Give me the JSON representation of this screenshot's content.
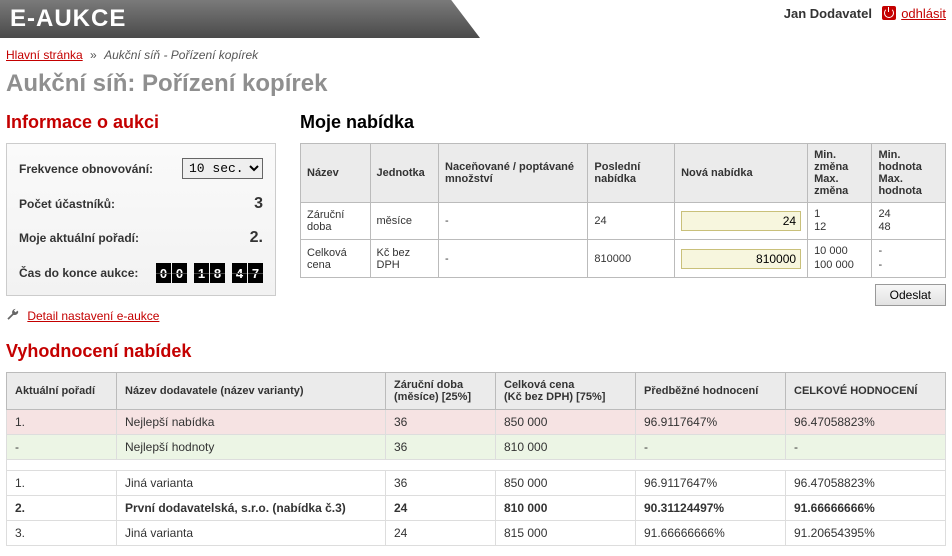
{
  "header": {
    "brand": "E-AUKCE",
    "user_name": "Jan Dodavatel",
    "logout_label": "odhlásit"
  },
  "breadcrumbs": {
    "home": "Hlavní stránka",
    "separator": "»",
    "tail": "Aukční síň - Pořízení kopírek"
  },
  "page_title": "Aukční síň: Pořízení kopírek",
  "info_panel": {
    "title": "Informace o aukci",
    "refresh_label": "Frekvence obnovování:",
    "refresh_value": "10 sec.",
    "participants_label": "Počet účastníků:",
    "participants_value": "3",
    "rank_label": "Moje aktuální pořadí:",
    "rank_value": "2.",
    "time_label": "Čas do konce aukce:",
    "countdown": {
      "hh": "00",
      "mm": "18",
      "ss": "47"
    },
    "detail_link": "Detail nastavení e-aukce"
  },
  "offer": {
    "title": "Moje nabídka",
    "cols": {
      "name": "Název",
      "unit": "Jednotka",
      "qty": "Naceňované / poptávané množství",
      "last": "Poslední nabídka",
      "new": "Nová nabídka",
      "minmax_change": "Min. změna\nMax. změna",
      "minmax_value": "Min. hodnota\nMax. hodnota"
    },
    "rows": [
      {
        "name": "Záruční doba",
        "unit": "měsíce",
        "qty": "-",
        "last": "24",
        "new": "24",
        "change_min": "1",
        "change_max": "12",
        "value_min": "24",
        "value_max": "48"
      },
      {
        "name": "Celková cena",
        "unit": "Kč bez DPH",
        "qty": "-",
        "last": "810000",
        "new": "810000",
        "change_min": "10 000",
        "change_max": "100 000",
        "value_min": "-",
        "value_max": "-"
      }
    ],
    "submit_label": "Odeslat"
  },
  "evaluation": {
    "title": "Vyhodnocení nabídek",
    "cols": {
      "rank": "Aktuální pořadí",
      "supplier": "Název dodavatele (název varianty)",
      "warranty": "Záruční doba\n(měsíce) [25%]",
      "price": "Celková cena\n(Kč bez DPH) [75%]",
      "pre_score": "Předběžné hodnocení",
      "total_score": "CELKOVÉ HODNOCENÍ"
    },
    "top_rows": [
      {
        "rank": "1.",
        "supplier": "Nejlepší nabídka",
        "warranty": "36",
        "price": "850 000",
        "pre_score": "96.9117647%",
        "total_score": "96.47058823%"
      },
      {
        "rank": "-",
        "supplier": "Nejlepší hodnoty",
        "warranty": "36",
        "price": "810 000",
        "pre_score": "-",
        "total_score": "-"
      }
    ],
    "rows": [
      {
        "rank": "1.",
        "supplier": "Jiná varianta",
        "warranty": "36",
        "price": "850 000",
        "pre_score": "96.9117647%",
        "total_score": "96.47058823%",
        "bold": false
      },
      {
        "rank": "2.",
        "supplier": "První dodavatelská, s.r.o. (nabídka č.3)",
        "warranty": "24",
        "price": "810 000",
        "pre_score": "90.31124497%",
        "total_score": "91.66666666%",
        "bold": true
      },
      {
        "rank": "3.",
        "supplier": "Jiná varianta",
        "warranty": "24",
        "price": "815 000",
        "pre_score": "91.66666666%",
        "total_score": "91.20654395%",
        "bold": false
      }
    ]
  }
}
